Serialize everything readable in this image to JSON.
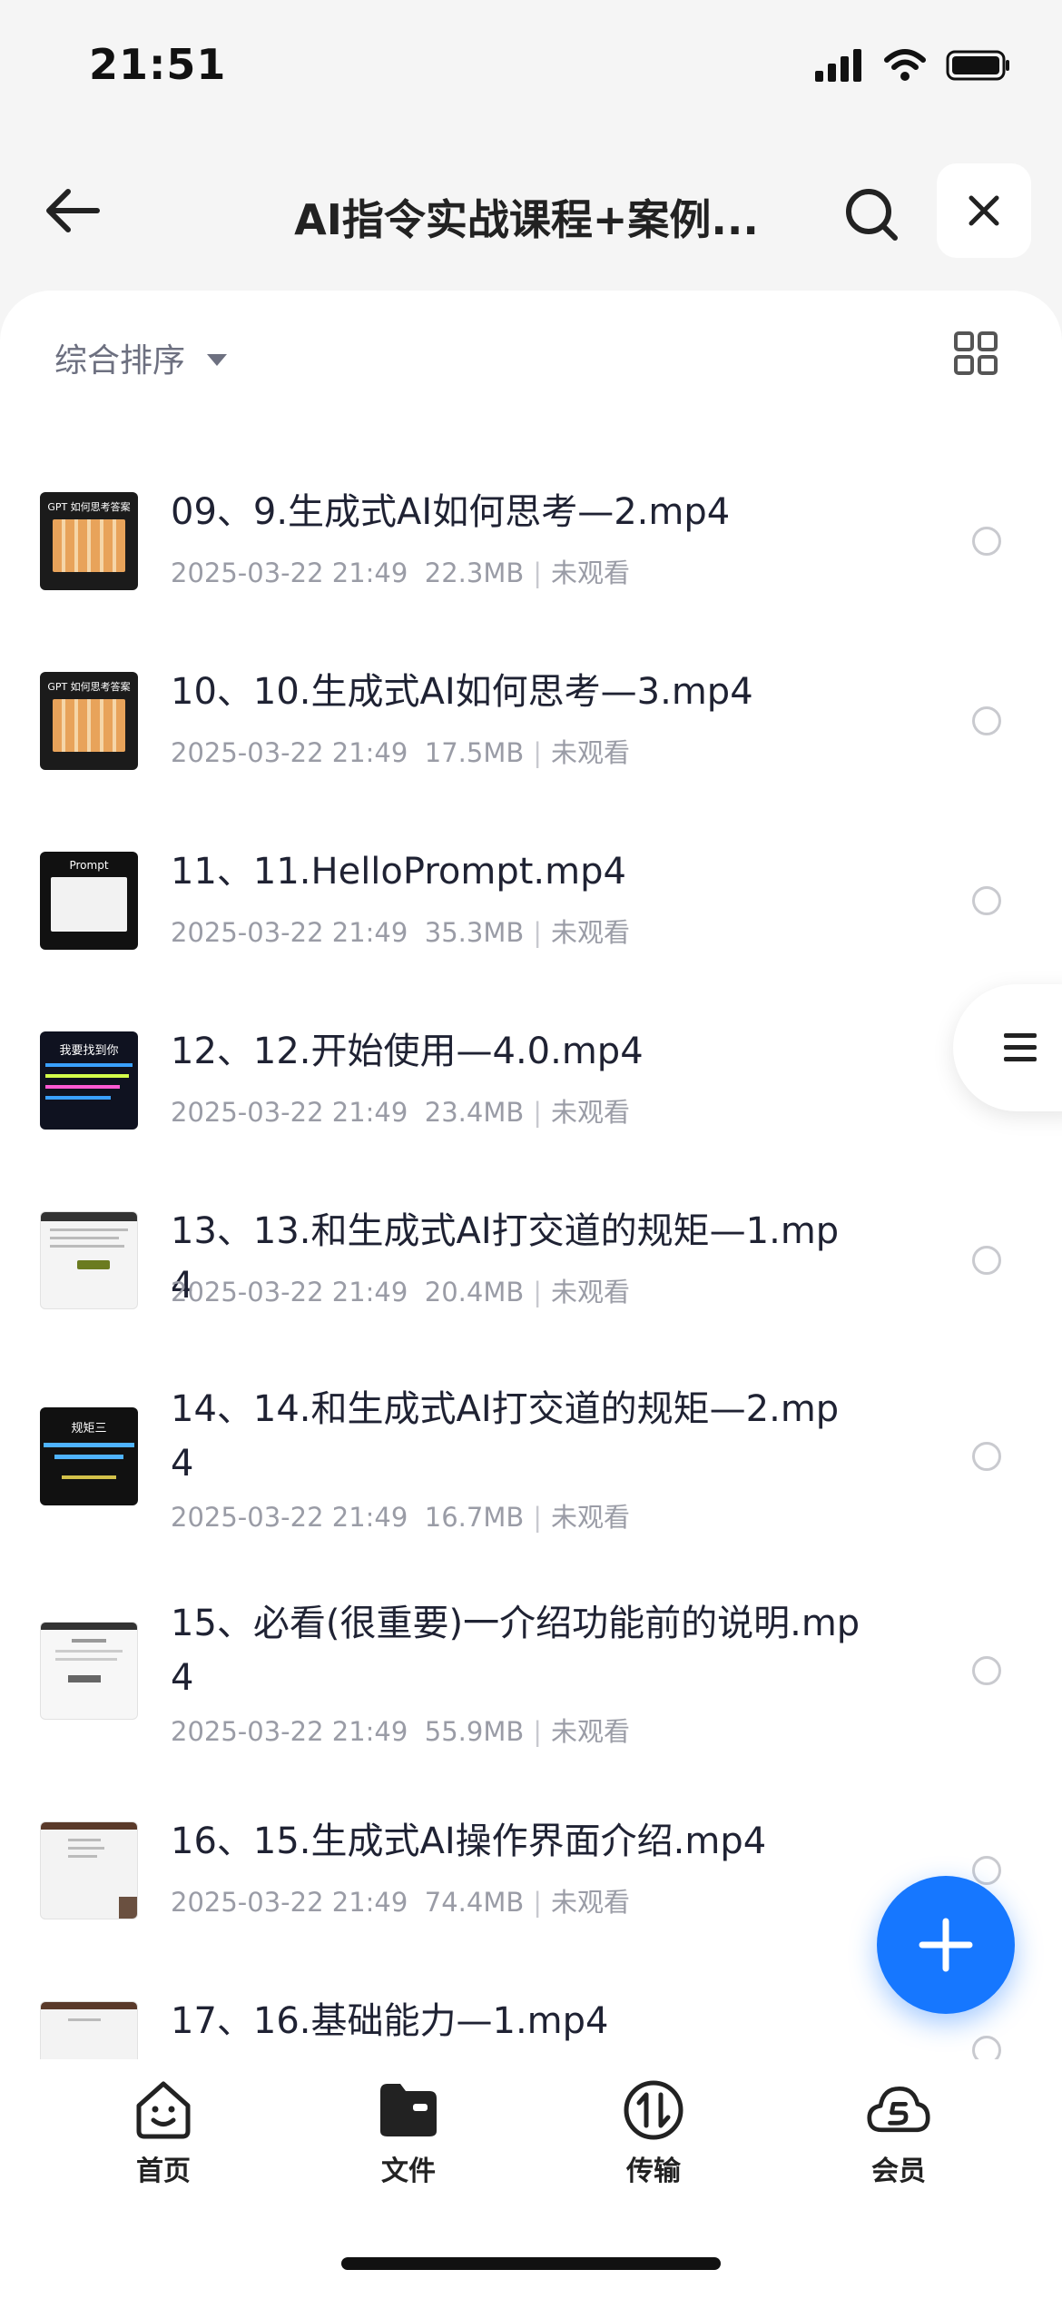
{
  "status": {
    "time": "21:51"
  },
  "header": {
    "title": "AI指令实战课程+案例..."
  },
  "sort": {
    "label": "综合排序"
  },
  "files": [
    {
      "name": "09、9.生成式AI如何思考—2.mp4",
      "date": "2025-03-22 21:49",
      "size": "22.3MB",
      "status": "未观看",
      "thumb_text": "GPT 如何思考答案"
    },
    {
      "name": "10、10.生成式AI如何思考—3.mp4",
      "date": "2025-03-22 21:49",
      "size": "17.5MB",
      "status": "未观看",
      "thumb_text": "GPT 如何思考答案"
    },
    {
      "name": "11、11.HelloPrompt.mp4",
      "date": "2025-03-22 21:49",
      "size": "35.3MB",
      "status": "未观看",
      "thumb_text": "Prompt"
    },
    {
      "name": "12、12.开始使用—4.0.mp4",
      "date": "2025-03-22 21:49",
      "size": "23.4MB",
      "status": "未观看",
      "thumb_text": "我要找到你"
    },
    {
      "name": "13、13.和生成式AI打交道的规矩—1.mp4",
      "date": "2025-03-22 21:49",
      "size": "20.4MB",
      "status": "未观看",
      "thumb_text": ""
    },
    {
      "name": "14、14.和生成式AI打交道的规矩—2.mp4",
      "date": "2025-03-22 21:49",
      "size": "16.7MB",
      "status": "未观看",
      "thumb_text": "规矩三"
    },
    {
      "name": "15、必看(很重要)一介绍功能前的说明.mp4",
      "date": "2025-03-22 21:49",
      "size": "55.9MB",
      "status": "未观看",
      "thumb_text": ""
    },
    {
      "name": "16、15.生成式AI操作界面介绍.mp4",
      "date": "2025-03-22 21:49",
      "size": "74.4MB",
      "status": "未观看",
      "thumb_text": ""
    },
    {
      "name": "17、16.基础能力—1.mp4",
      "date": "",
      "size": "",
      "status": "",
      "thumb_text": ""
    }
  ],
  "nav": {
    "home": "首页",
    "files": "文件",
    "transfer": "传输",
    "member": "会员"
  },
  "colors": {
    "accent": "#1677ff",
    "text": "#1f2233",
    "muted": "#9a9ca6"
  }
}
